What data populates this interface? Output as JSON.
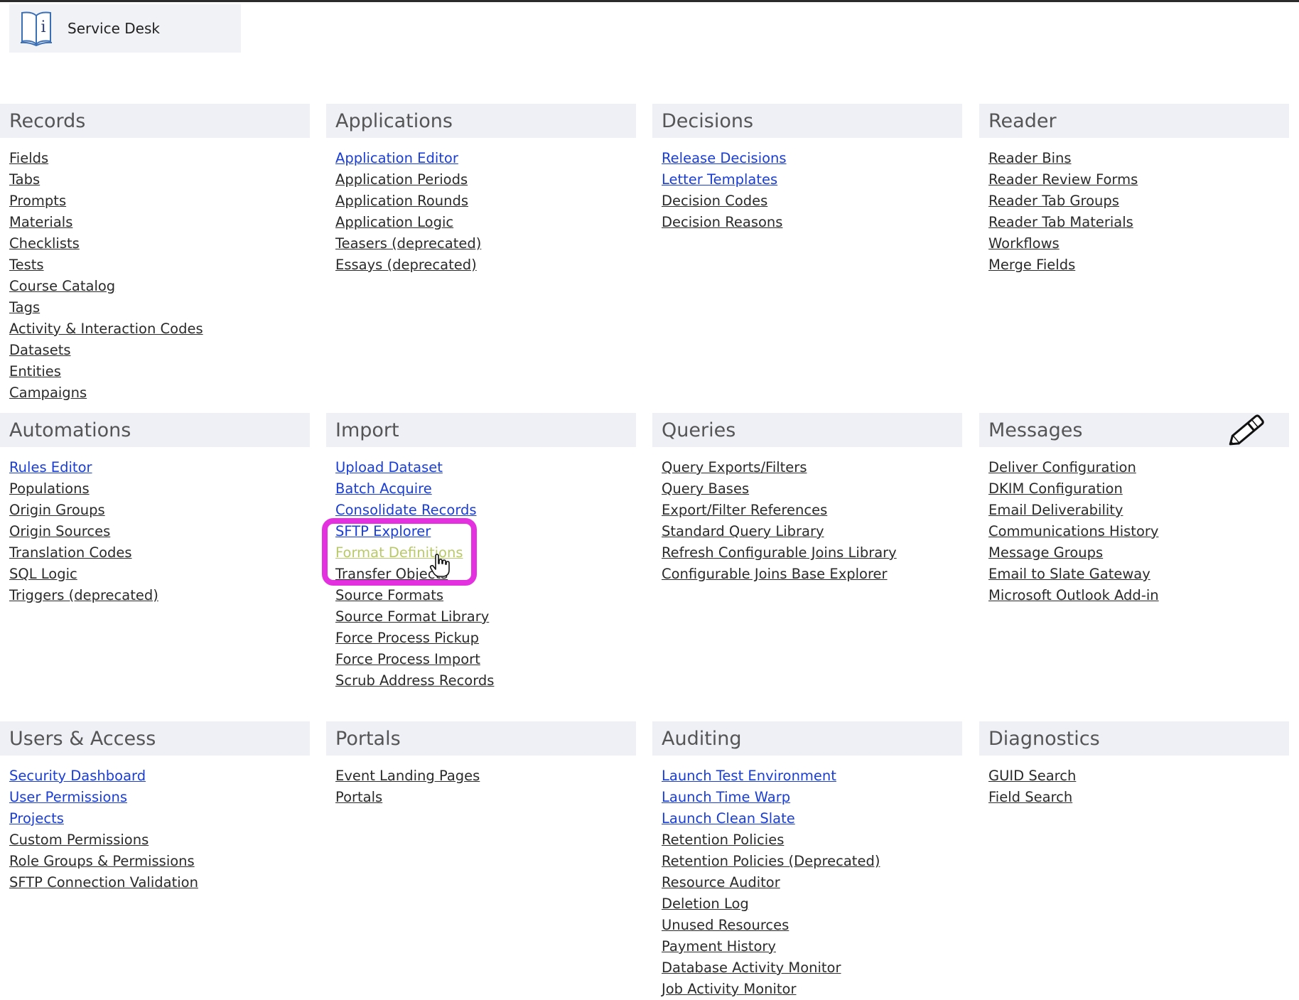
{
  "header": {
    "service_desk_label": "Service Desk"
  },
  "icons": {
    "service_desk": "book-info-icon",
    "pencil": "pencil-icon",
    "cursor": "hand-pointer-icon"
  },
  "colors": {
    "link": "#2a2a2a",
    "link_active": "#1a3dd6",
    "link_hover": "#b9c96a",
    "highlight": "#e431e0",
    "header_bg": "#eef0f6"
  },
  "sections": {
    "records": {
      "title": "Records",
      "items": [
        {
          "label": "Fields",
          "blue": false
        },
        {
          "label": "Tabs",
          "blue": false
        },
        {
          "label": "Prompts",
          "blue": false
        },
        {
          "label": "Materials",
          "blue": false
        },
        {
          "label": "Checklists",
          "blue": false
        },
        {
          "label": "Tests",
          "blue": false
        },
        {
          "label": "Course Catalog",
          "blue": false
        },
        {
          "label": "Tags",
          "blue": false
        },
        {
          "label": "Activity & Interaction Codes",
          "blue": false
        },
        {
          "label": "Datasets",
          "blue": false
        },
        {
          "label": "Entities",
          "blue": false
        },
        {
          "label": "Campaigns",
          "blue": false
        }
      ]
    },
    "applications": {
      "title": "Applications",
      "items": [
        {
          "label": "Application Editor",
          "blue": true
        },
        {
          "label": "Application Periods",
          "blue": false
        },
        {
          "label": "Application Rounds",
          "blue": false
        },
        {
          "label": "Application Logic",
          "blue": false
        },
        {
          "label": "Teasers (deprecated)",
          "blue": false
        },
        {
          "label": "Essays (deprecated)",
          "blue": false
        }
      ]
    },
    "decisions": {
      "title": "Decisions",
      "items": [
        {
          "label": "Release Decisions",
          "blue": true
        },
        {
          "label": "Letter Templates",
          "blue": true
        },
        {
          "label": "Decision Codes",
          "blue": false
        },
        {
          "label": "Decision Reasons",
          "blue": false
        }
      ]
    },
    "reader": {
      "title": "Reader",
      "items": [
        {
          "label": "Reader Bins",
          "blue": false
        },
        {
          "label": "Reader Review Forms",
          "blue": false
        },
        {
          "label": "Reader Tab Groups",
          "blue": false
        },
        {
          "label": "Reader Tab Materials",
          "blue": false
        },
        {
          "label": "Workflows",
          "blue": false
        },
        {
          "label": "Merge Fields",
          "blue": false
        }
      ]
    },
    "automations": {
      "title": "Automations",
      "items": [
        {
          "label": "Rules Editor",
          "blue": true
        },
        {
          "label": "Populations",
          "blue": false
        },
        {
          "label": "Origin Groups",
          "blue": false
        },
        {
          "label": "Origin Sources",
          "blue": false
        },
        {
          "label": "Translation Codes",
          "blue": false
        },
        {
          "label": "SQL Logic",
          "blue": false
        },
        {
          "label": "Triggers (deprecated)",
          "blue": false
        }
      ]
    },
    "import": {
      "title": "Import",
      "items": [
        {
          "label": "Upload Dataset",
          "blue": true
        },
        {
          "label": "Batch Acquire",
          "blue": true
        },
        {
          "label": "Consolidate Records",
          "blue": true
        },
        {
          "label": "SFTP Explorer",
          "blue": true
        },
        {
          "label": "Format Definitions",
          "blue": false,
          "hovered": true
        },
        {
          "label": "Transfer Objects",
          "blue": false
        },
        {
          "label": "Source Formats",
          "blue": false
        },
        {
          "label": "Source Format Library",
          "blue": false
        },
        {
          "label": "Force Process Pickup",
          "blue": false
        },
        {
          "label": "Force Process Import",
          "blue": false
        },
        {
          "label": "Scrub Address Records",
          "blue": false
        }
      ]
    },
    "queries": {
      "title": "Queries",
      "items": [
        {
          "label": "Query Exports/Filters",
          "blue": false
        },
        {
          "label": "Query Bases",
          "blue": false
        },
        {
          "label": "Export/Filter References",
          "blue": false
        },
        {
          "label": "Standard Query Library",
          "blue": false
        },
        {
          "label": "Refresh Configurable Joins Library",
          "blue": false
        },
        {
          "label": "Configurable Joins Base Explorer",
          "blue": false
        }
      ]
    },
    "messages": {
      "title": "Messages",
      "items": [
        {
          "label": "Deliver Configuration",
          "blue": false
        },
        {
          "label": "DKIM Configuration",
          "blue": false
        },
        {
          "label": "Email Deliverability",
          "blue": false
        },
        {
          "label": "Communications History",
          "blue": false
        },
        {
          "label": "Message Groups",
          "blue": false
        },
        {
          "label": "Email to Slate Gateway",
          "blue": false
        },
        {
          "label": "Microsoft Outlook Add-in",
          "blue": false
        }
      ]
    },
    "users_access": {
      "title": "Users & Access",
      "items": [
        {
          "label": "Security Dashboard",
          "blue": true
        },
        {
          "label": "User Permissions",
          "blue": true
        },
        {
          "label": "Projects",
          "blue": true
        },
        {
          "label": "Custom Permissions",
          "blue": false
        },
        {
          "label": "Role Groups & Permissions",
          "blue": false
        },
        {
          "label": "SFTP Connection Validation",
          "blue": false
        }
      ]
    },
    "portals": {
      "title": "Portals",
      "items": [
        {
          "label": "Event Landing Pages",
          "blue": false
        },
        {
          "label": "Portals",
          "blue": false
        }
      ]
    },
    "auditing": {
      "title": "Auditing",
      "items": [
        {
          "label": "Launch Test Environment",
          "blue": true
        },
        {
          "label": "Launch Time Warp",
          "blue": true
        },
        {
          "label": "Launch Clean Slate",
          "blue": true
        },
        {
          "label": "Retention Policies",
          "blue": false
        },
        {
          "label": "Retention Policies (Deprecated)",
          "blue": false
        },
        {
          "label": "Resource Auditor",
          "blue": false
        },
        {
          "label": "Deletion Log",
          "blue": false
        },
        {
          "label": "Unused Resources",
          "blue": false
        },
        {
          "label": "Payment History",
          "blue": false
        },
        {
          "label": "Database Activity Monitor",
          "blue": false
        },
        {
          "label": "Job Activity Monitor",
          "blue": false
        }
      ]
    },
    "diagnostics": {
      "title": "Diagnostics",
      "items": [
        {
          "label": "GUID Search",
          "blue": false
        },
        {
          "label": "Field Search",
          "blue": false
        }
      ]
    }
  }
}
